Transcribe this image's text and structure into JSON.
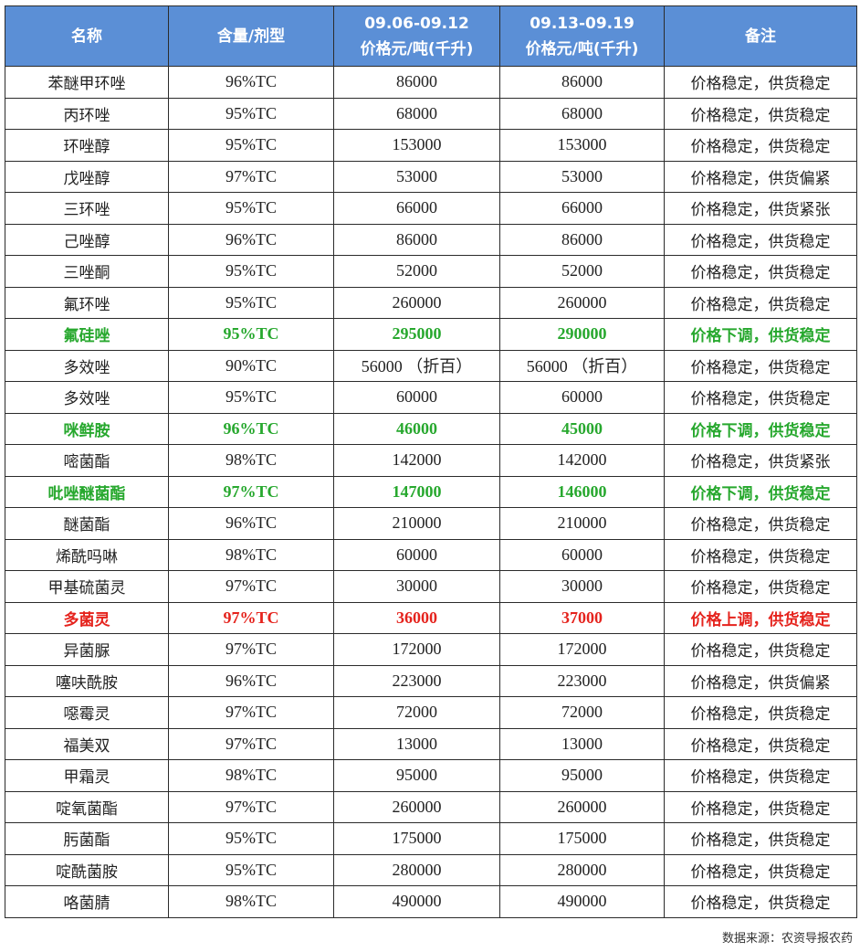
{
  "header": {
    "name": "名称",
    "spec": "含量/剂型",
    "week1_range": "09.06-09.12",
    "week1_unit": "价格元/吨(千升)",
    "week2_range": "09.13-09.19",
    "week2_unit": "价格元/吨(千升)",
    "note": "备注"
  },
  "rows": [
    {
      "name": "苯醚甲环唑",
      "spec": "96%TC",
      "p1": "86000",
      "p2": "86000",
      "note": "价格稳定，供货稳定",
      "status": "normal"
    },
    {
      "name": "丙环唑",
      "spec": "95%TC",
      "p1": "68000",
      "p2": "68000",
      "note": "价格稳定，供货稳定",
      "status": "normal"
    },
    {
      "name": "环唑醇",
      "spec": "95%TC",
      "p1": "153000",
      "p2": "153000",
      "note": "价格稳定，供货稳定",
      "status": "normal"
    },
    {
      "name": "戊唑醇",
      "spec": "97%TC",
      "p1": "53000",
      "p2": "53000",
      "note": "价格稳定，供货偏紧",
      "status": "normal"
    },
    {
      "name": "三环唑",
      "spec": "95%TC",
      "p1": "66000",
      "p2": "66000",
      "note": "价格稳定，供货紧张",
      "status": "normal"
    },
    {
      "name": "己唑醇",
      "spec": "96%TC",
      "p1": "86000",
      "p2": "86000",
      "note": "价格稳定，供货稳定",
      "status": "normal"
    },
    {
      "name": "三唑酮",
      "spec": "95%TC",
      "p1": "52000",
      "p2": "52000",
      "note": "价格稳定，供货稳定",
      "status": "normal"
    },
    {
      "name": "氟环唑",
      "spec": "95%TC",
      "p1": "260000",
      "p2": "260000",
      "note": "价格稳定，供货稳定",
      "status": "normal"
    },
    {
      "name": "氟硅唑",
      "spec": "95%TC",
      "p1": "295000",
      "p2": "290000",
      "note": "价格下调，供货稳定",
      "status": "down"
    },
    {
      "name": "多效唑",
      "spec": "90%TC",
      "p1": "56000 （折百）",
      "p2": "56000 （折百）",
      "note": "价格稳定，供货稳定",
      "status": "normal"
    },
    {
      "name": "多效唑",
      "spec": "95%TC",
      "p1": "60000",
      "p2": "60000",
      "note": "价格稳定，供货稳定",
      "status": "normal"
    },
    {
      "name": "咪鲜胺",
      "spec": "96%TC",
      "p1": "46000",
      "p2": "45000",
      "note": "价格下调，供货稳定",
      "status": "down"
    },
    {
      "name": "嘧菌酯",
      "spec": "98%TC",
      "p1": "142000",
      "p2": "142000",
      "note": "价格稳定，供货紧张",
      "status": "normal"
    },
    {
      "name": "吡唑醚菌酯",
      "spec": "97%TC",
      "p1": "147000",
      "p2": "146000",
      "note": "价格下调，供货稳定",
      "status": "down"
    },
    {
      "name": "醚菌酯",
      "spec": "96%TC",
      "p1": "210000",
      "p2": "210000",
      "note": "价格稳定，供货稳定",
      "status": "normal"
    },
    {
      "name": "烯酰吗啉",
      "spec": "98%TC",
      "p1": "60000",
      "p2": "60000",
      "note": "价格稳定，供货稳定",
      "status": "normal"
    },
    {
      "name": "甲基硫菌灵",
      "spec": "97%TC",
      "p1": "30000",
      "p2": "30000",
      "note": "价格稳定，供货稳定",
      "status": "normal"
    },
    {
      "name": "多菌灵",
      "spec": "97%TC",
      "p1": "36000",
      "p2": "37000",
      "note": "价格上调，供货稳定",
      "status": "up"
    },
    {
      "name": "异菌脲",
      "spec": "97%TC",
      "p1": "172000",
      "p2": "172000",
      "note": "价格稳定，供货稳定",
      "status": "normal"
    },
    {
      "name": "噻呋酰胺",
      "spec": "96%TC",
      "p1": "223000",
      "p2": "223000",
      "note": "价格稳定，供货偏紧",
      "status": "normal"
    },
    {
      "name": "噁霉灵",
      "spec": "97%TC",
      "p1": "72000",
      "p2": "72000",
      "note": "价格稳定，供货稳定",
      "status": "normal"
    },
    {
      "name": "福美双",
      "spec": "97%TC",
      "p1": "13000",
      "p2": "13000",
      "note": "价格稳定，供货稳定",
      "status": "normal"
    },
    {
      "name": "甲霜灵",
      "spec": "98%TC",
      "p1": "95000",
      "p2": "95000",
      "note": "价格稳定，供货稳定",
      "status": "normal"
    },
    {
      "name": "啶氧菌酯",
      "spec": "97%TC",
      "p1": "260000",
      "p2": "260000",
      "note": "价格稳定，供货稳定",
      "status": "normal"
    },
    {
      "name": "肟菌酯",
      "spec": "95%TC",
      "p1": "175000",
      "p2": "175000",
      "note": "价格稳定，供货稳定",
      "status": "normal"
    },
    {
      "name": "啶酰菌胺",
      "spec": "95%TC",
      "p1": "280000",
      "p2": "280000",
      "note": "价格稳定，供货稳定",
      "status": "normal"
    },
    {
      "name": "咯菌腈",
      "spec": "98%TC",
      "p1": "490000",
      "p2": "490000",
      "note": "价格稳定，供货稳定",
      "status": "normal"
    }
  ],
  "source": "数据来源：农资导报农药",
  "colors": {
    "header_bg": "#5b8fd6",
    "down": "#27a82e",
    "up": "#e5231d"
  }
}
